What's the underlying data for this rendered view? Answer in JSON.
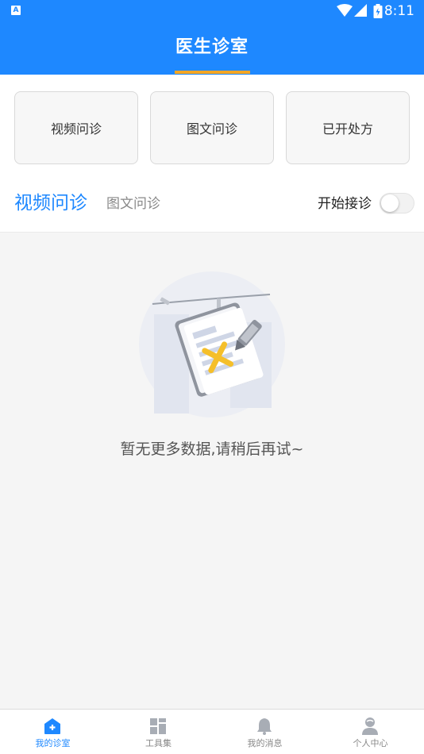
{
  "status_bar": {
    "time": "8:11",
    "app_badge": "A"
  },
  "header": {
    "title": "医生诊室"
  },
  "cards": [
    {
      "label": "视频问诊"
    },
    {
      "label": "图文问诊"
    },
    {
      "label": "已开处方"
    }
  ],
  "tabs": {
    "active": "视频问诊",
    "inactive": "图文问诊"
  },
  "accept": {
    "label": "开始接诊",
    "enabled": false
  },
  "empty_state": {
    "message": "暂无更多数据,请稍后再试~"
  },
  "bottom_nav": [
    {
      "label": "我的诊室",
      "icon": "home-plus-icon",
      "active": true
    },
    {
      "label": "工具集",
      "icon": "grid-icon",
      "active": false
    },
    {
      "label": "我的消息",
      "icon": "bell-icon",
      "active": false
    },
    {
      "label": "个人中心",
      "icon": "person-icon",
      "active": false
    }
  ],
  "colors": {
    "primary": "#1e88ff",
    "accent": "#f5a623"
  }
}
